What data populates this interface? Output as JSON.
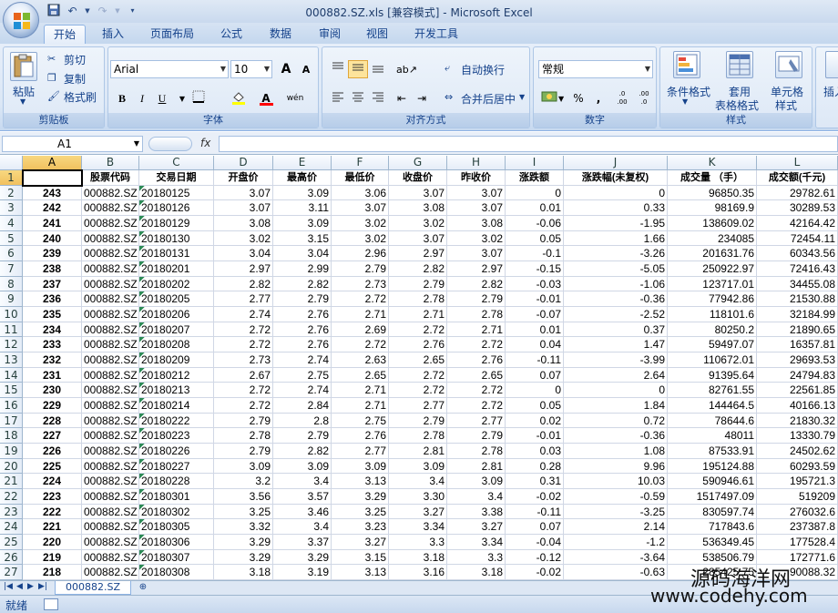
{
  "window": {
    "title": "000882.SZ.xls  [兼容模式] - Microsoft Excel"
  },
  "tabs": [
    "开始",
    "插入",
    "页面布局",
    "公式",
    "数据",
    "审阅",
    "视图",
    "开发工具"
  ],
  "ribbon": {
    "clipboard": {
      "label": "剪贴板",
      "paste": "粘贴",
      "cut": "剪切",
      "copy": "复制",
      "format_painter": "格式刷"
    },
    "font": {
      "label": "字体",
      "name": "Arial",
      "size": "10",
      "grow": "A",
      "shrink": "A",
      "bold": "B",
      "italic": "I",
      "underline": "U",
      "color": "A",
      "phonetic": "wén"
    },
    "alignment": {
      "label": "对齐方式",
      "wrap": "自动换行",
      "merge": "合并后居中"
    },
    "number": {
      "label": "数字",
      "format": "常规",
      "percent": "%",
      "comma": ",",
      "inc_dec": ".0 .00",
      "dec_dec": ".00 .0"
    },
    "styles": {
      "label": "样式",
      "conditional": "条件格式",
      "table_line1": "套用",
      "table_line2": "表格格式",
      "cell_line1": "单元格",
      "cell_line2": "样式"
    },
    "insert_partial": "插入"
  },
  "formula_bar": {
    "name_box": "A1",
    "fx": "fx",
    "content": ""
  },
  "status": {
    "ready": "就绪"
  },
  "sheet_tab": "000882.SZ",
  "watermark": {
    "line1": "源码海洋网",
    "line2": "www.codehy.com"
  },
  "columns": [
    {
      "letter": "A",
      "header": ""
    },
    {
      "letter": "B",
      "header": "股票代码"
    },
    {
      "letter": "C",
      "header": "交易日期"
    },
    {
      "letter": "D",
      "header": "开盘价"
    },
    {
      "letter": "E",
      "header": "最高价"
    },
    {
      "letter": "F",
      "header": "最低价"
    },
    {
      "letter": "G",
      "header": "收盘价"
    },
    {
      "letter": "H",
      "header": "昨收价"
    },
    {
      "letter": "I",
      "header": "涨跌额"
    },
    {
      "letter": "J",
      "header": "涨跌幅(未复权)"
    },
    {
      "letter": "K",
      "header": "成交量 （手）"
    },
    {
      "letter": "L",
      "header": "成交额(千元)"
    }
  ],
  "rows": [
    [
      "243",
      "000882.SZ",
      "20180125",
      "3.07",
      "3.09",
      "3.06",
      "3.07",
      "3.07",
      "0",
      "0",
      "96850.35",
      "29782.61"
    ],
    [
      "242",
      "000882.SZ",
      "20180126",
      "3.07",
      "3.11",
      "3.07",
      "3.08",
      "3.07",
      "0.01",
      "0.33",
      "98169.9",
      "30289.53"
    ],
    [
      "241",
      "000882.SZ",
      "20180129",
      "3.08",
      "3.09",
      "3.02",
      "3.02",
      "3.08",
      "-0.06",
      "-1.95",
      "138609.02",
      "42164.42"
    ],
    [
      "240",
      "000882.SZ",
      "20180130",
      "3.02",
      "3.15",
      "3.02",
      "3.07",
      "3.02",
      "0.05",
      "1.66",
      "234085",
      "72454.11"
    ],
    [
      "239",
      "000882.SZ",
      "20180131",
      "3.04",
      "3.04",
      "2.96",
      "2.97",
      "3.07",
      "-0.1",
      "-3.26",
      "201631.76",
      "60343.56"
    ],
    [
      "238",
      "000882.SZ",
      "20180201",
      "2.97",
      "2.99",
      "2.79",
      "2.82",
      "2.97",
      "-0.15",
      "-5.05",
      "250922.97",
      "72416.43"
    ],
    [
      "237",
      "000882.SZ",
      "20180202",
      "2.82",
      "2.82",
      "2.73",
      "2.79",
      "2.82",
      "-0.03",
      "-1.06",
      "123717.01",
      "34455.08"
    ],
    [
      "236",
      "000882.SZ",
      "20180205",
      "2.77",
      "2.79",
      "2.72",
      "2.78",
      "2.79",
      "-0.01",
      "-0.36",
      "77942.86",
      "21530.88"
    ],
    [
      "235",
      "000882.SZ",
      "20180206",
      "2.74",
      "2.76",
      "2.71",
      "2.71",
      "2.78",
      "-0.07",
      "-2.52",
      "118101.6",
      "32184.99"
    ],
    [
      "234",
      "000882.SZ",
      "20180207",
      "2.72",
      "2.76",
      "2.69",
      "2.72",
      "2.71",
      "0.01",
      "0.37",
      "80250.2",
      "21890.65"
    ],
    [
      "233",
      "000882.SZ",
      "20180208",
      "2.72",
      "2.76",
      "2.72",
      "2.76",
      "2.72",
      "0.04",
      "1.47",
      "59497.07",
      "16357.81"
    ],
    [
      "232",
      "000882.SZ",
      "20180209",
      "2.73",
      "2.74",
      "2.63",
      "2.65",
      "2.76",
      "-0.11",
      "-3.99",
      "110672.01",
      "29693.53"
    ],
    [
      "231",
      "000882.SZ",
      "20180212",
      "2.67",
      "2.75",
      "2.65",
      "2.72",
      "2.65",
      "0.07",
      "2.64",
      "91395.64",
      "24794.83"
    ],
    [
      "230",
      "000882.SZ",
      "20180213",
      "2.72",
      "2.74",
      "2.71",
      "2.72",
      "2.72",
      "0",
      "0",
      "82761.55",
      "22561.85"
    ],
    [
      "229",
      "000882.SZ",
      "20180214",
      "2.72",
      "2.84",
      "2.71",
      "2.77",
      "2.72",
      "0.05",
      "1.84",
      "144464.5",
      "40166.13"
    ],
    [
      "228",
      "000882.SZ",
      "20180222",
      "2.79",
      "2.8",
      "2.75",
      "2.79",
      "2.77",
      "0.02",
      "0.72",
      "78644.6",
      "21830.32"
    ],
    [
      "227",
      "000882.SZ",
      "20180223",
      "2.78",
      "2.79",
      "2.76",
      "2.78",
      "2.79",
      "-0.01",
      "-0.36",
      "48011",
      "13330.79"
    ],
    [
      "226",
      "000882.SZ",
      "20180226",
      "2.79",
      "2.82",
      "2.77",
      "2.81",
      "2.78",
      "0.03",
      "1.08",
      "87533.91",
      "24502.62"
    ],
    [
      "225",
      "000882.SZ",
      "20180227",
      "3.09",
      "3.09",
      "3.09",
      "3.09",
      "2.81",
      "0.28",
      "9.96",
      "195124.88",
      "60293.59"
    ],
    [
      "224",
      "000882.SZ",
      "20180228",
      "3.2",
      "3.4",
      "3.13",
      "3.4",
      "3.09",
      "0.31",
      "10.03",
      "590946.61",
      "195721.3"
    ],
    [
      "223",
      "000882.SZ",
      "20180301",
      "3.56",
      "3.57",
      "3.29",
      "3.30",
      "3.4",
      "-0.02",
      "-0.59",
      "1517497.09",
      "519209"
    ],
    [
      "222",
      "000882.SZ",
      "20180302",
      "3.25",
      "3.46",
      "3.25",
      "3.27",
      "3.38",
      "-0.11",
      "-3.25",
      "830597.74",
      "276032.6"
    ],
    [
      "221",
      "000882.SZ",
      "20180305",
      "3.32",
      "3.4",
      "3.23",
      "3.34",
      "3.27",
      "0.07",
      "2.14",
      "717843.6",
      "237387.8"
    ],
    [
      "220",
      "000882.SZ",
      "20180306",
      "3.29",
      "3.37",
      "3.27",
      "3.3",
      "3.34",
      "-0.04",
      "-1.2",
      "536349.45",
      "177528.4"
    ],
    [
      "219",
      "000882.SZ",
      "20180307",
      "3.29",
      "3.29",
      "3.15",
      "3.18",
      "3.3",
      "-0.12",
      "-3.64",
      "538506.79",
      "172771.6"
    ],
    [
      "218",
      "000882.SZ",
      "20180308",
      "3.18",
      "3.19",
      "3.13",
      "3.16",
      "3.18",
      "-0.02",
      "-0.63",
      "285425.75",
      "90088.32"
    ],
    [
      "217",
      "000882.SZ",
      "20180309",
      "3.15",
      "3.4",
      "3.11",
      "3.23",
      "3.16",
      "0.07",
      "2.22",
      "624070.77",
      "202006.2"
    ],
    [
      "216",
      "000882.SZ",
      "20180312",
      "3.28",
      "3.38",
      "3.24",
      "3.33",
      "3.23",
      "0.1",
      "3.1",
      "692352.36",
      "228265"
    ]
  ]
}
